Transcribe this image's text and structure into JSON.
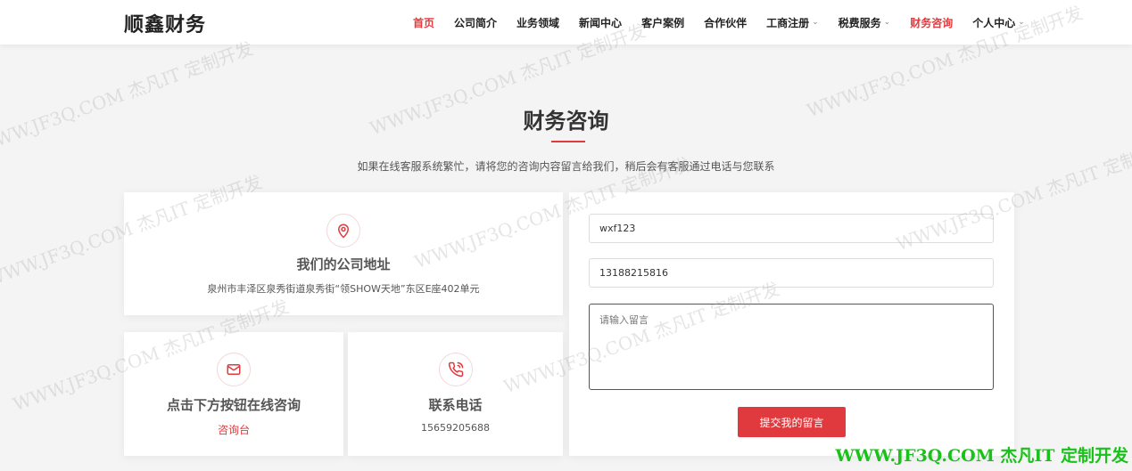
{
  "header": {
    "logo": "顺鑫财务",
    "nav": [
      {
        "label": "首页",
        "active": true,
        "dropdown": false
      },
      {
        "label": "公司简介",
        "active": false,
        "dropdown": false
      },
      {
        "label": "业务领域",
        "active": false,
        "dropdown": false
      },
      {
        "label": "新闻中心",
        "active": false,
        "dropdown": false
      },
      {
        "label": "客户案例",
        "active": false,
        "dropdown": false
      },
      {
        "label": "合作伙伴",
        "active": false,
        "dropdown": false
      },
      {
        "label": "工商注册",
        "active": false,
        "dropdown": true
      },
      {
        "label": "税费服务",
        "active": false,
        "dropdown": true
      },
      {
        "label": "财务咨询",
        "active": true,
        "dropdown": false
      },
      {
        "label": "个人中心",
        "active": false,
        "dropdown": true
      }
    ]
  },
  "main": {
    "title": "财务咨询",
    "subtitle": "如果在线客服系统繁忙，请将您的咨询内容留言给我们，稍后会有客服通过电话与您联系"
  },
  "address_card": {
    "icon": "map-pin-icon",
    "title": "我们的公司地址",
    "text": "泉州市丰泽区泉秀街道泉秀街“领SHOW天地”东区E座402单元"
  },
  "chat_card": {
    "icon": "mail-icon",
    "title": "点击下方按钮在线咨询",
    "link": "咨询台"
  },
  "phone_card": {
    "icon": "phone-icon",
    "title": "联系电话",
    "text": "15659205688"
  },
  "form": {
    "name_value": "wxf123",
    "phone_value": "13188215816",
    "message_placeholder": "请输入留言",
    "submit_label": "提交我的留言"
  },
  "watermark": {
    "text": "WWW.JF3Q.COM 杰凡IT 定制开发",
    "banner": "WWW.JF3Q.COM 杰凡IT  定制开发"
  },
  "colors": {
    "accent": "#e03a3e",
    "watermark_banner": "#19c219"
  }
}
